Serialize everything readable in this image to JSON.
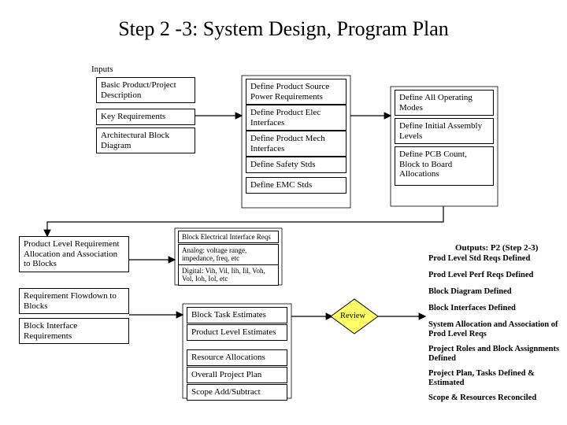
{
  "title": "Step 2 -3:  System Design, Program Plan",
  "inputs_label": "Inputs",
  "inputs": {
    "a": "Basic Product/Project Description",
    "b": "Key Requirements",
    "c": "Architectural Block Diagram"
  },
  "col2": {
    "a": "Define Product Source Power Requirements",
    "b": "Define Product Elec Interfaces",
    "c": "Define Product Mech Interfaces",
    "d": "Define Safety Stds",
    "e": "Define EMC Stds"
  },
  "col3": {
    "a": "Define All Operating Modes",
    "b": "Define Initial Assembly Levels",
    "c": "Define PCB Count, Block to Board Allocations"
  },
  "left2": {
    "a": "Product Level Requirement Allocation and Association to Blocks",
    "b": "Requirement Flowdown to Blocks",
    "c": "Block Interface Requirements"
  },
  "mid2": {
    "a": "Block Electrical Interface Reqs",
    "b": "Analog:  voltage range, impedance, freq, etc",
    "c": "Digital:  Vih, Vil, Iih, Iil, Voh, Vol, Ioh, Iol, etc"
  },
  "est": {
    "a": "Block Task Estimates",
    "b": "Product Level Estimates",
    "c": "Resource Allocations",
    "d": "Overall Project Plan",
    "e": "Scope Add/Subtract"
  },
  "review": "Review",
  "outputs": {
    "header": "Outputs:  P2 (Step 2-3)",
    "a": "Prod Level Std Reqs Defined",
    "b": "Prod Level Perf Reqs Defined",
    "c": "Block Diagram Defined",
    "d": "Block Interfaces Defined",
    "e": "System Allocation and Association of Prod Level Reqs",
    "f": "Project Roles and Block Assignments Defined",
    "g": "Project Plan,  Tasks Defined & Estimated",
    "h": "Scope & Resources Reconciled"
  }
}
